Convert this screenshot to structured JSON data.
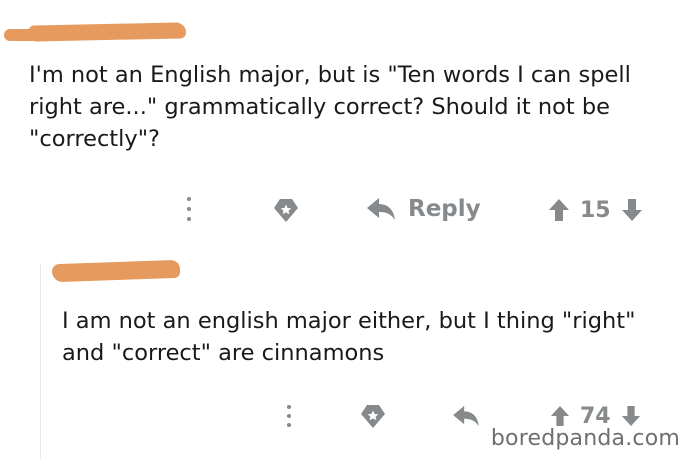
{
  "comment_1": {
    "text": "I'm not an English major, but is \"Ten words I can spell right are...\" grammatically correct? Should it not be \"correctly\"?",
    "reply_label": "Reply",
    "score": "15"
  },
  "comment_2": {
    "text": "I am not an english major either, but I thing \"right\" and \"correct\" are cinnamons",
    "score": "74"
  },
  "watermark": "boredpanda.com",
  "colors": {
    "redaction": "#e69a5d",
    "icon_gray": "#878a8c",
    "text": "#1a1a1a"
  }
}
